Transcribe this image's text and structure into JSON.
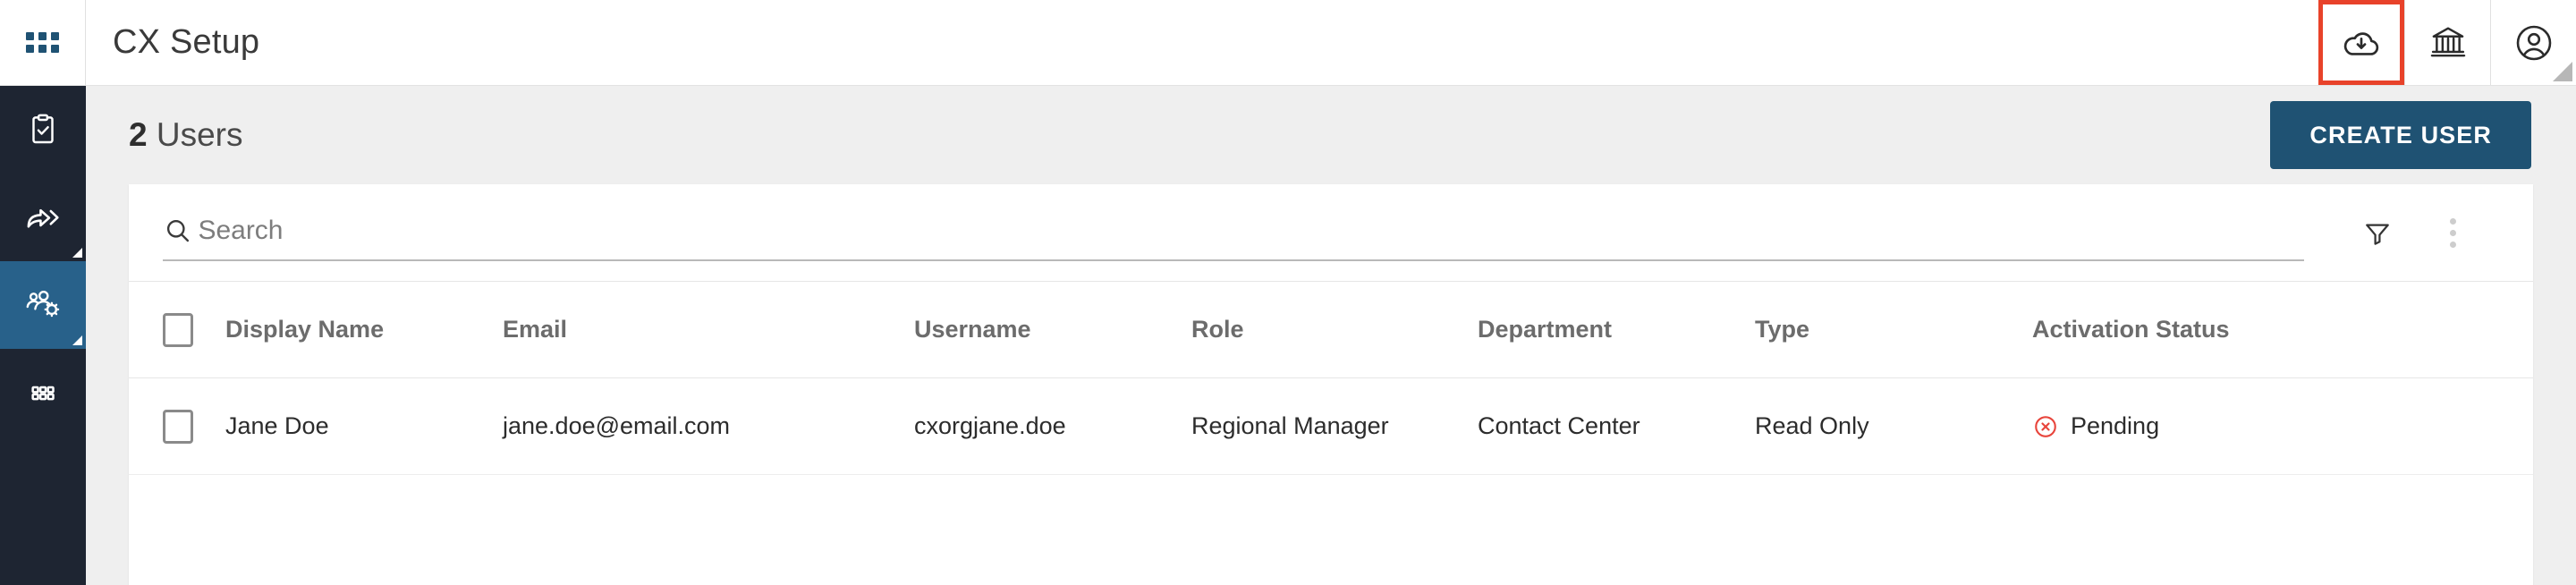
{
  "header": {
    "title": "CX Setup",
    "waffle_icon": "apps-grid-icon",
    "actions": [
      {
        "icon": "cloud-download-icon",
        "highlighted": true
      },
      {
        "icon": "bank-institution-icon",
        "highlighted": false
      },
      {
        "icon": "user-account-circle-icon",
        "highlighted": false
      }
    ],
    "highlight_color": "#e8422a"
  },
  "sidebar": {
    "background": "#1e2532",
    "active_color": "#28618a",
    "items": [
      {
        "icon": "clipboard-check-icon",
        "active": false,
        "has_corner_marker": false
      },
      {
        "icon": "share-arrow-icon",
        "active": false,
        "has_corner_marker": true
      },
      {
        "icon": "users-gear-icon",
        "active": true,
        "has_corner_marker": true
      },
      {
        "icon": "keypad-grid-icon",
        "active": false,
        "has_corner_marker": false
      }
    ]
  },
  "page": {
    "count": "2",
    "count_label": "Users",
    "create_button": "CREATE USER",
    "accent_color": "#1f5273"
  },
  "search": {
    "placeholder": "Search",
    "value": "",
    "search_icon": "search-icon",
    "filter_icon": "filter-funnel-icon",
    "kebab_icon": "more-vertical-icon"
  },
  "table": {
    "columns": [
      "Display Name",
      "Email",
      "Username",
      "Role",
      "Department",
      "Type",
      "Activation Status"
    ],
    "rows": [
      {
        "display_name": "Jane Doe",
        "email": "jane.doe@email.com",
        "username": "cxorgjane.doe",
        "role": "Regional Manager",
        "department": "Contact Center",
        "type": "Read Only",
        "activation_status": "Pending",
        "status_icon": "circle-x-icon",
        "status_color": "#e8453c"
      }
    ]
  }
}
